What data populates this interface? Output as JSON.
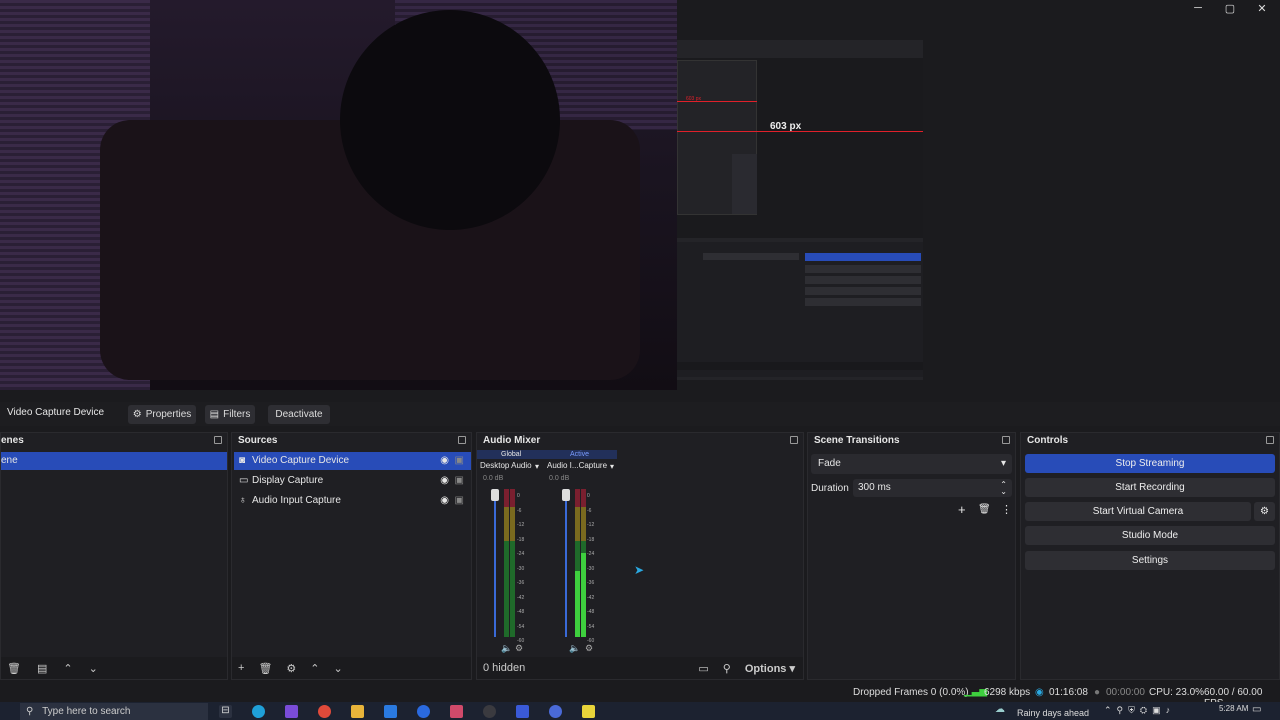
{
  "window": {
    "minimize_label": "─",
    "maximize_label": "▢",
    "close_label": "✕"
  },
  "preview": {
    "measure_label": "603 px",
    "measure_label_small": "603 px"
  },
  "source_toolbar": {
    "selected_source": "Video Capture Device",
    "properties_label": "Properties",
    "filters_label": "Filters",
    "deactivate_label": "Deactivate"
  },
  "scenes": {
    "title": "enes",
    "items": [
      {
        "label": "ene",
        "selected": true
      }
    ]
  },
  "sources": {
    "title": "Sources",
    "items": [
      {
        "label": "Video Capture Device",
        "icon": "camera-icon",
        "selected": true
      },
      {
        "label": "Display Capture",
        "icon": "monitor-icon",
        "selected": false
      },
      {
        "label": "Audio Input Capture",
        "icon": "microphone-icon",
        "selected": false
      }
    ]
  },
  "audio_mixer": {
    "title": "Audio Mixer",
    "global_label": "Global",
    "active_label": "Active",
    "channels": [
      {
        "name": "Desktop Audio",
        "db": "0.0 dB"
      },
      {
        "name": "Audio I...Capture",
        "db": "0.0 dB"
      }
    ],
    "scale": [
      "0",
      "-6",
      "-12",
      "-18",
      "-24",
      "-30",
      "-36",
      "-42",
      "-48",
      "-54",
      "-60"
    ],
    "hidden_label": "0 hidden",
    "options_label": "Options"
  },
  "scene_transitions": {
    "title": "Scene Transitions",
    "transition": "Fade",
    "duration_label": "Duration",
    "duration_value": "300 ms"
  },
  "controls": {
    "title": "Controls",
    "stop_streaming": "Stop Streaming",
    "start_recording": "Start Recording",
    "start_virtual_camera": "Start Virtual Camera",
    "studio_mode": "Studio Mode",
    "settings": "Settings"
  },
  "status": {
    "dropped_frames": "Dropped Frames 0 (0.0%)",
    "bitrate": "6298 kbps",
    "stream_time": "01:16:08",
    "rec_time": "00:00:00",
    "cpu": "CPU: 23.0%",
    "fps": "60.00 / 60.00 FPS"
  },
  "taskbar": {
    "search_placeholder": "Type here to search",
    "weather": "Rainy days ahead",
    "time": "5:28 AM"
  },
  "colors": {
    "accent": "#284cb8",
    "meter_green": "#3ecf3e",
    "measure_red": "#e0202a"
  }
}
